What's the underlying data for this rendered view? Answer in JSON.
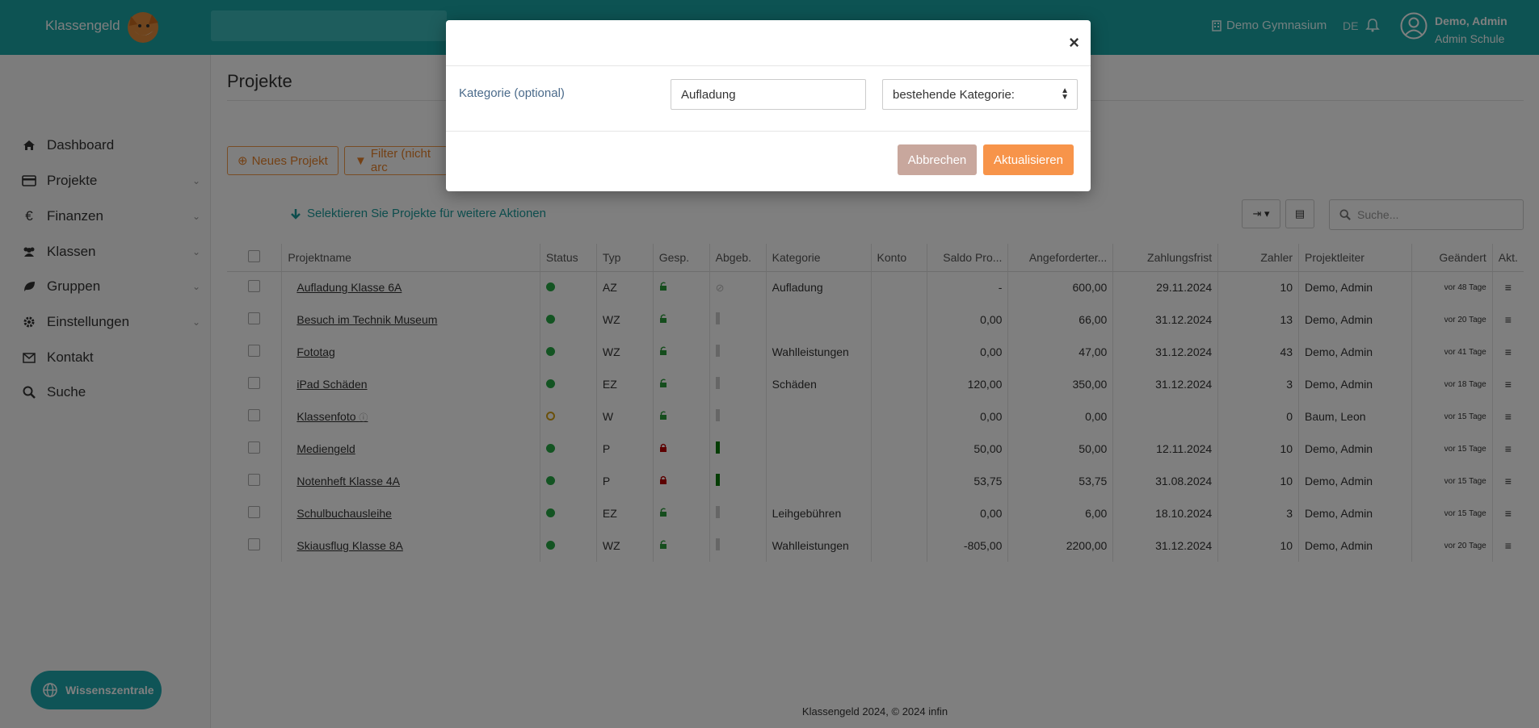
{
  "header": {
    "brand": "Klassengeld",
    "school": "Demo Gymnasium",
    "lang": "DE",
    "user_name": "Demo, Admin",
    "user_role": "Admin Schule"
  },
  "sidebar": {
    "items": [
      {
        "label": "Dashboard",
        "icon": "home-icon"
      },
      {
        "label": "Projekte",
        "icon": "card-icon"
      },
      {
        "label": "Finanzen",
        "icon": "euro-icon"
      },
      {
        "label": "Klassen",
        "icon": "users-icon"
      },
      {
        "label": "Gruppen",
        "icon": "leaf-icon"
      },
      {
        "label": "Einstellungen",
        "icon": "gear-icon"
      },
      {
        "label": "Kontakt",
        "icon": "envelope-icon"
      },
      {
        "label": "Suche",
        "icon": "search-icon"
      }
    ],
    "help_button": "Wissenszentrale"
  },
  "main": {
    "title": "Projekte",
    "new_project": "Neues Projekt",
    "filter": "Filter (nicht arc",
    "select_hint": "Selektieren Sie Projekte für weitere Aktionen",
    "search_placeholder": "Suche...",
    "columns": [
      "Projektname",
      "Status",
      "Typ",
      "Gesp.",
      "Abgeb.",
      "Kategorie",
      "Konto",
      "Saldo Pro...",
      "Angeforderter...",
      "Zahlungsfrist",
      "Zahler",
      "Projektleiter",
      "Geändert",
      "Akt."
    ],
    "rows": [
      {
        "name": "Aufladung Klasse 6A",
        "status": "active",
        "typ": "AZ",
        "locked": false,
        "abgeb": "none",
        "kategorie": "Aufladung",
        "konto": "",
        "saldo": "-",
        "angefordert": "600,00",
        "frist": "29.11.2024",
        "zahler": "10",
        "leiter": "Demo, Admin",
        "geaendert": "vor 48 Tage"
      },
      {
        "name": "Besuch im Technik Museum",
        "status": "active",
        "typ": "WZ",
        "locked": false,
        "abgeb": "empty",
        "kategorie": "",
        "konto": "",
        "saldo": "0,00",
        "angefordert": "66,00",
        "frist": "31.12.2024",
        "zahler": "13",
        "leiter": "Demo, Admin",
        "geaendert": "vor 20 Tage"
      },
      {
        "name": "Fototag",
        "status": "active",
        "typ": "WZ",
        "locked": false,
        "abgeb": "empty",
        "kategorie": "Wahlleistungen",
        "konto": "",
        "saldo": "0,00",
        "angefordert": "47,00",
        "frist": "31.12.2024",
        "zahler": "43",
        "leiter": "Demo, Admin",
        "geaendert": "vor 41 Tage"
      },
      {
        "name": "iPad Schäden",
        "status": "active",
        "typ": "EZ",
        "locked": false,
        "abgeb": "empty",
        "kategorie": "Schäden",
        "konto": "",
        "saldo": "120,00",
        "angefordert": "350,00",
        "frist": "31.12.2024",
        "zahler": "3",
        "leiter": "Demo, Admin",
        "geaendert": "vor 18 Tage"
      },
      {
        "name": "Klassenfoto",
        "status": "pending",
        "typ": "W",
        "locked": false,
        "abgeb": "empty",
        "kategorie": "",
        "konto": "",
        "saldo": "0,00",
        "angefordert": "0,00",
        "frist": "",
        "zahler": "0",
        "leiter": "Baum, Leon",
        "geaendert": "vor 15 Tage",
        "info": true
      },
      {
        "name": "Mediengeld",
        "status": "active",
        "typ": "P",
        "locked": true,
        "abgeb": "full",
        "kategorie": "",
        "konto": "",
        "saldo": "50,00",
        "angefordert": "50,00",
        "frist": "12.11.2024",
        "zahler": "10",
        "leiter": "Demo, Admin",
        "geaendert": "vor 15 Tage"
      },
      {
        "name": "Notenheft Klasse 4A",
        "status": "active",
        "typ": "P",
        "locked": true,
        "abgeb": "full",
        "kategorie": "",
        "konto": "",
        "saldo": "53,75",
        "angefordert": "53,75",
        "frist": "31.08.2024",
        "zahler": "10",
        "leiter": "Demo, Admin",
        "geaendert": "vor 15 Tage"
      },
      {
        "name": "Schulbuchausleihe",
        "status": "active",
        "typ": "EZ",
        "locked": false,
        "abgeb": "empty",
        "kategorie": "Leihgebühren",
        "konto": "",
        "saldo": "0,00",
        "angefordert": "6,00",
        "frist": "18.10.2024",
        "zahler": "3",
        "leiter": "Demo, Admin",
        "geaendert": "vor 15 Tage"
      },
      {
        "name": "Skiausflug Klasse 8A",
        "status": "active",
        "typ": "WZ",
        "locked": false,
        "abgeb": "empty",
        "kategorie": "Wahlleistungen",
        "konto": "",
        "saldo": "-805,00",
        "angefordert": "2200,00",
        "frist": "31.12.2024",
        "zahler": "10",
        "leiter": "Demo, Admin",
        "geaendert": "vor 20 Tage"
      }
    ]
  },
  "footer": "Klassengeld 2024, © 2024 infin",
  "modal": {
    "label": "Kategorie (optional)",
    "input_value": "Aufladung",
    "select_value": "bestehende Kategorie:",
    "cancel": "Abbrechen",
    "submit": "Aktualisieren",
    "close": "×"
  },
  "colors": {
    "teal": "#1aa6a6",
    "orange": "#f7944a",
    "cancel": "#c8a79d"
  }
}
